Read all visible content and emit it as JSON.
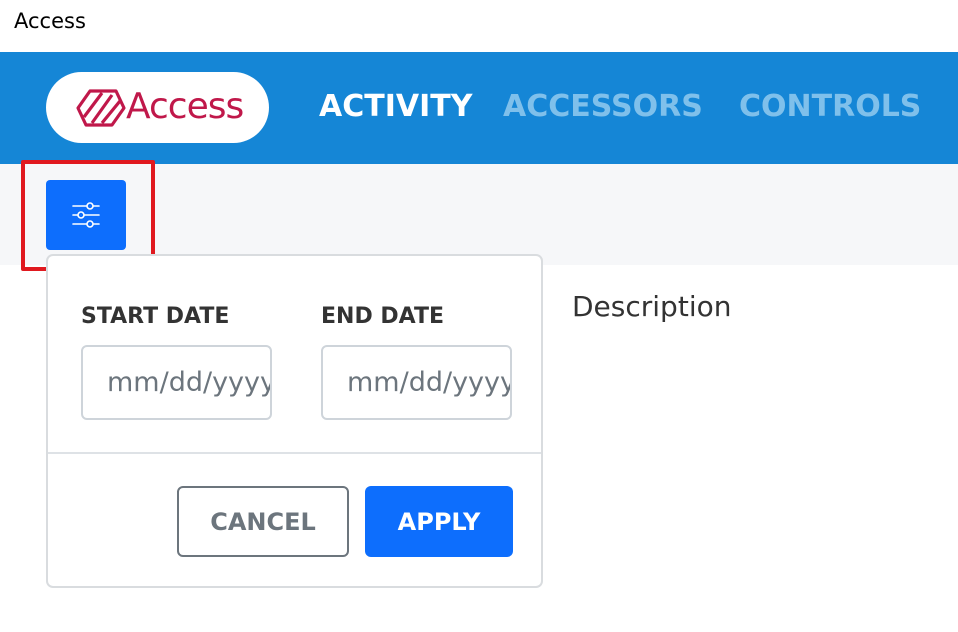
{
  "window": {
    "title": "Access"
  },
  "brand": {
    "name": "Access",
    "color": "#c0184a",
    "icon": "access-logo-icon"
  },
  "nav": {
    "background": "#1586d6",
    "items": [
      {
        "label": "ACTIVITY",
        "active": true
      },
      {
        "label": "ACCESSORS",
        "active": false
      },
      {
        "label": "CONTROLS",
        "active": false
      }
    ]
  },
  "toolbar": {
    "filter_button_icon": "sliders-icon",
    "accent": "#0d6efd",
    "highlight_color": "#e0191f"
  },
  "filter_popover": {
    "start_label": "START DATE",
    "start_placeholder": "mm/dd/yyyy",
    "end_label": "END DATE",
    "end_placeholder": "mm/dd/yyyy",
    "cancel_label": "CANCEL",
    "apply_label": "APPLY"
  },
  "table": {
    "description_header": "Description"
  }
}
